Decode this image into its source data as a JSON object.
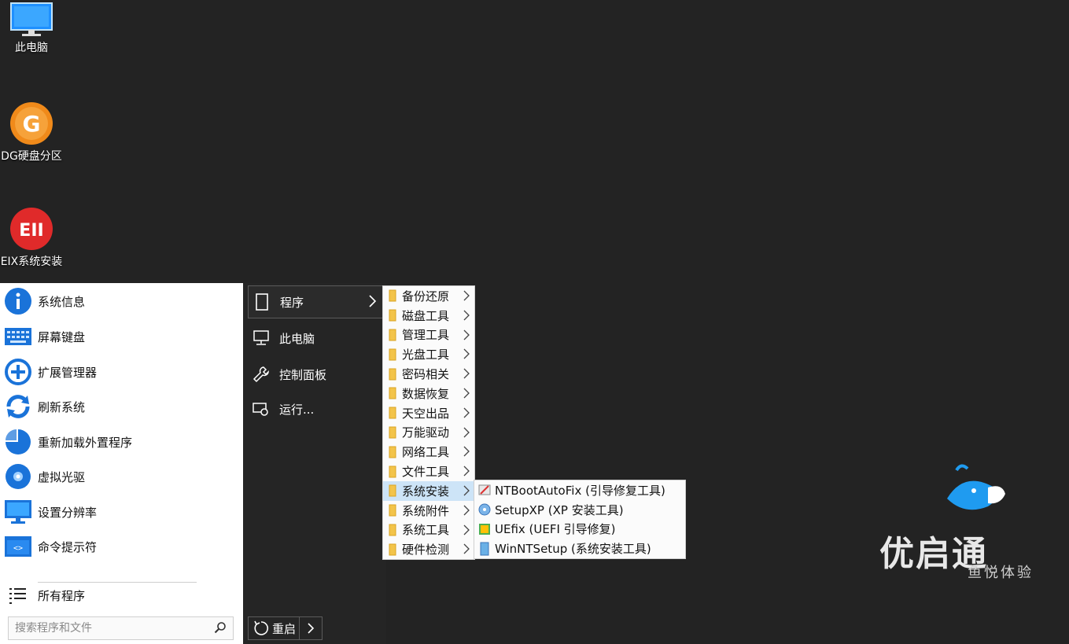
{
  "desktop": {
    "icons": [
      {
        "label": "此电脑"
      },
      {
        "label": "DG硬盘分区"
      },
      {
        "label": "EIX系统安装"
      }
    ],
    "dg_badge": "G",
    "eix_badge": "EII"
  },
  "start_menu": {
    "left_items": [
      {
        "label": "系统信息",
        "icon": "info-icon"
      },
      {
        "label": "屏幕键盘",
        "icon": "keyboard-icon"
      },
      {
        "label": "扩展管理器",
        "icon": "plus-circle-icon"
      },
      {
        "label": "刷新系统",
        "icon": "refresh-icon"
      },
      {
        "label": "重新加载外置程序",
        "icon": "pie-icon"
      },
      {
        "label": "虚拟光驱",
        "icon": "disc-icon"
      },
      {
        "label": "设置分辨率",
        "icon": "monitor-icon"
      },
      {
        "label": "命令提示符",
        "icon": "cmd-icon"
      }
    ],
    "all_programs": "所有程序",
    "search_placeholder": "搜索程序和文件",
    "mid_items": [
      {
        "label": "程序",
        "icon": "document-icon"
      },
      {
        "label": "此电脑",
        "icon": "computer-icon"
      },
      {
        "label": "控制面板",
        "icon": "wrench-icon"
      },
      {
        "label": "运行...",
        "icon": "run-icon"
      }
    ],
    "restart_label": "重启"
  },
  "programs_submenu": [
    "备份还原",
    "磁盘工具",
    "管理工具",
    "光盘工具",
    "密码相关",
    "数据恢复",
    "天空出品",
    "万能驱动",
    "网络工具",
    "文件工具",
    "系统安装",
    "系统附件",
    "系统工具",
    "硬件检测"
  ],
  "system_install_submenu": [
    "NTBootAutoFix (引导修复工具)",
    "SetupXP (XP 安装工具)",
    "UEfix (UEFI 引导修复)",
    "WinNTSetup (系统安装工具)"
  ],
  "watermark": {
    "title": "优启通",
    "subtitle": "鱼悦体验"
  },
  "colors": {
    "desktop_bg": "#232323",
    "accent_blue": "#1a73d9",
    "highlight": "#cde4f7"
  }
}
